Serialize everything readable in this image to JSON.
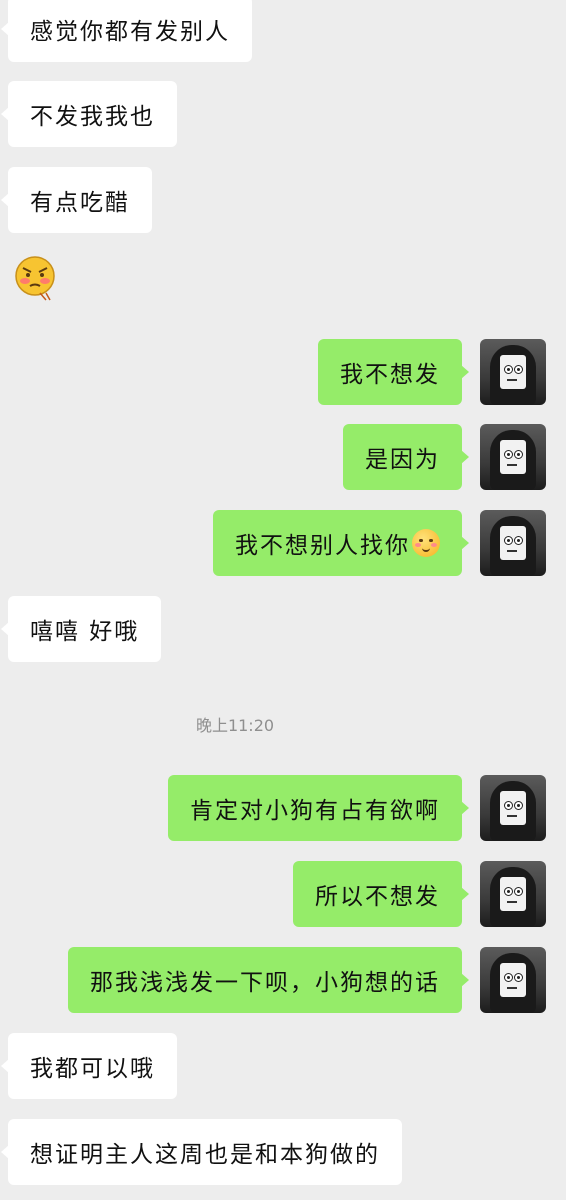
{
  "messages": [
    {
      "side": "in",
      "text": "感觉你都有发别人"
    },
    {
      "side": "in",
      "text": "不发我我也"
    },
    {
      "side": "in",
      "text": "有点吃醋"
    },
    {
      "side": "in",
      "sticker": "angry-blushing-face-sticker"
    },
    {
      "side": "out",
      "text": "我不想发"
    },
    {
      "side": "out",
      "text": "是因为"
    },
    {
      "side": "out",
      "text": "我不想别人找你",
      "emoji": "blushing-smile-emoji"
    },
    {
      "side": "in",
      "text": "嘻嘻 好哦"
    },
    {
      "side": "out",
      "text": "肯定对小狗有占有欲啊"
    },
    {
      "side": "out",
      "text": "所以不想发"
    },
    {
      "side": "out",
      "text": "那我浅浅发一下呗，小狗想的话"
    },
    {
      "side": "in",
      "text": "我都可以哦"
    },
    {
      "side": "in",
      "text": "想证明主人这周也是和本狗做的"
    }
  ],
  "timestamp": "晚上11:20",
  "colors": {
    "background": "#ededed",
    "incoming_bubble": "#ffffff",
    "outgoing_bubble": "#95ec69"
  },
  "avatar": {
    "icon": "masked-hooded-avatar"
  }
}
